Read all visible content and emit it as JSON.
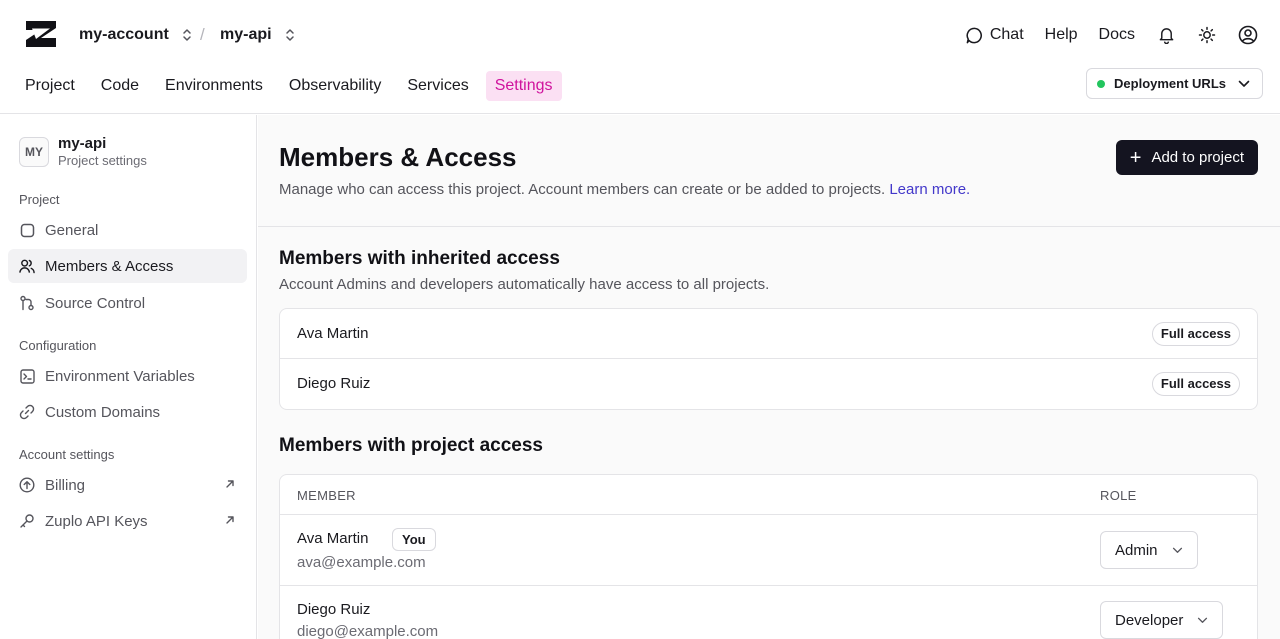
{
  "header": {
    "account": "my-account",
    "separator": "/",
    "project": "my-api",
    "links": {
      "chat": "Chat",
      "help": "Help",
      "docs": "Docs"
    },
    "nav": [
      "Project",
      "Code",
      "Environments",
      "Observability",
      "Services",
      "Settings"
    ],
    "active_nav": "Settings",
    "deployment_button": "Deployment URLs",
    "status_color": "#22c55e",
    "accent_color": "#d0139d"
  },
  "sidebar": {
    "avatar": "MY",
    "project_name": "my-api",
    "project_sub": "Project settings",
    "groups": {
      "project": "Project",
      "configuration": "Configuration",
      "account": "Account settings"
    },
    "items": {
      "general": "General",
      "members": "Members & Access",
      "source": "Source Control",
      "env": "Environment Variables",
      "domains": "Custom Domains",
      "billing": "Billing",
      "keys": "Zuplo API Keys"
    }
  },
  "main": {
    "title": "Members & Access",
    "description": "Manage who can access this project. Account members can create or be added to projects.",
    "learn_more": "Learn more.",
    "add_button": "Add to project",
    "inherited": {
      "title": "Members with inherited access",
      "description": "Account Admins and developers automatically have access to all projects.",
      "members": [
        {
          "name": "Ava Martin",
          "badge": "Full access"
        },
        {
          "name": "Diego Ruiz",
          "badge": "Full access"
        }
      ]
    },
    "project_access": {
      "title": "Members with project access",
      "col_member": "MEMBER",
      "col_role": "ROLE",
      "you_badge": "You",
      "members": [
        {
          "name": "Ava Martin",
          "email": "ava@example.com",
          "role": "Admin"
        },
        {
          "name": "Diego Ruiz",
          "email": "diego@example.com",
          "role": "Developer"
        }
      ]
    }
  }
}
